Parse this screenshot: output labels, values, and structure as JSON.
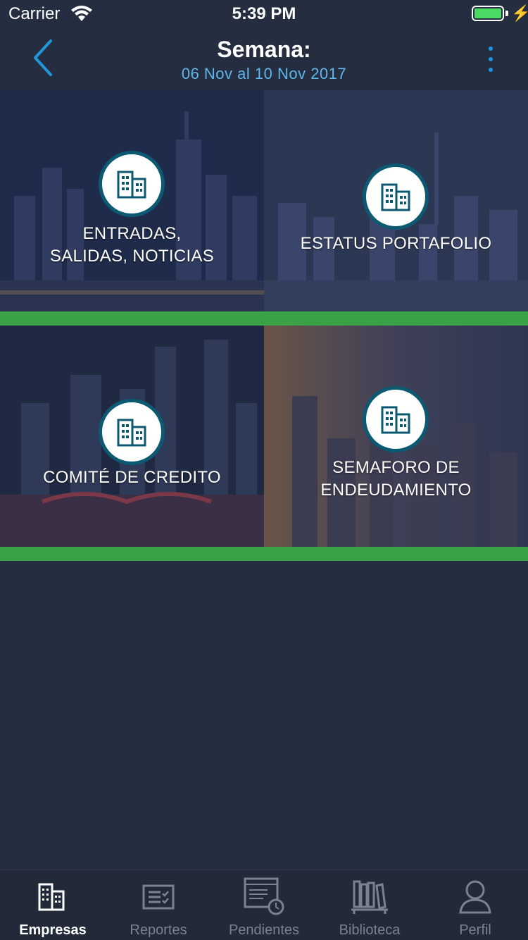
{
  "status_bar": {
    "carrier": "Carrier",
    "time": "5:39 PM"
  },
  "header": {
    "title": "Semana:",
    "subtitle": "06 Nov al 10 Nov 2017"
  },
  "tiles": [
    {
      "label": "ENTRADAS,\nSALIDAS, NOTICIAS",
      "icon": "building-icon"
    },
    {
      "label": "ESTATUS PORTAFOLIO",
      "icon": "building-icon"
    },
    {
      "label": "COMITÉ DE CREDITO",
      "icon": "building-icon"
    },
    {
      "label": "SEMAFORO DE\nENDEUDAMIENTO",
      "icon": "building-icon"
    }
  ],
  "tabbar": {
    "items": [
      {
        "label": "Empresas",
        "icon": "buildings-icon",
        "active": true
      },
      {
        "label": "Reportes",
        "icon": "report-icon",
        "active": false
      },
      {
        "label": "Pendientes",
        "icon": "pending-icon",
        "active": false
      },
      {
        "label": "Biblioteca",
        "icon": "library-icon",
        "active": false
      },
      {
        "label": "Perfil",
        "icon": "profile-icon",
        "active": false
      }
    ]
  },
  "colors": {
    "accent": "#2196d8",
    "subtitle": "#5fb6e8",
    "tile_bar": "#3aa147",
    "background": "#252e40",
    "icon_ring": "#0c5a72",
    "battery": "#4cd964"
  }
}
